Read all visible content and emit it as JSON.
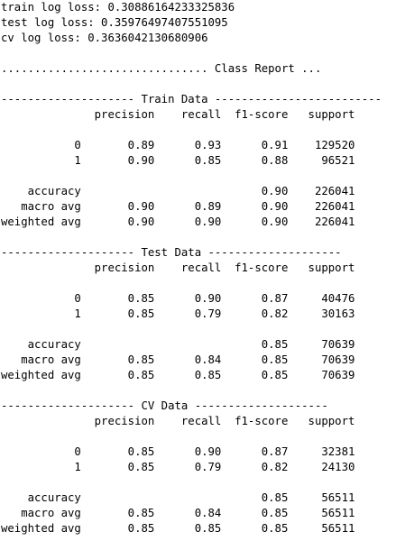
{
  "output": {
    "lines": [
      "train log loss: 0.30886164233325836",
      "test log loss: 0.35976497407551095",
      "cv log loss: 0.3636042130680906",
      "",
      "............................... Class Report ...",
      "",
      "-------------------- Train Data -------------------------",
      "              precision    recall  f1-score   support",
      "",
      "           0       0.89      0.93      0.91    129520",
      "           1       0.90      0.85      0.88     96521",
      "",
      "    accuracy                           0.90    226041",
      "   macro avg       0.90      0.89      0.90    226041",
      "weighted avg       0.90      0.90      0.90    226041",
      "",
      "-------------------- Test Data --------------------",
      "              precision    recall  f1-score   support",
      "",
      "           0       0.85      0.90      0.87     40476",
      "           1       0.85      0.79      0.82     30163",
      "",
      "    accuracy                           0.85     70639",
      "   macro avg       0.85      0.84      0.85     70639",
      "weighted avg       0.85      0.85      0.85     70639",
      "",
      "-------------------- CV Data --------------------",
      "              precision    recall  f1-score   support",
      "",
      "           0       0.85      0.90      0.87     32381",
      "           1       0.85      0.79      0.82     24130",
      "",
      "    accuracy                           0.85     56511",
      "   macro avg       0.85      0.84      0.85     56511",
      "weighted avg       0.85      0.85      0.85     56511"
    ]
  }
}
